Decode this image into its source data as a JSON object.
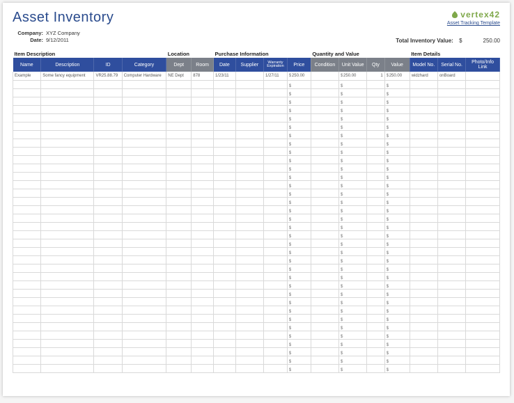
{
  "title": "Asset Inventory",
  "brand": {
    "name": "vertex42",
    "link_text": "Asset Tracking Template"
  },
  "meta": {
    "company_label": "Company:",
    "company": "XYZ Company",
    "date_label": "Date:",
    "date": "9/12/2011",
    "total_label": "Total Inventory Value:",
    "total_currency": "$",
    "total_value": "250.00"
  },
  "groups": {
    "item_desc": "Item Description",
    "location": "Location",
    "purchase": "Purchase Information",
    "quantity": "Quantity and Value",
    "details": "Item Details"
  },
  "columns": {
    "name": "Name",
    "desc": "Description",
    "id": "ID",
    "cat": "Category",
    "dept": "Dept",
    "room": "Room",
    "date": "Date",
    "supplier": "Supplier",
    "warranty": "Warranty Expiration",
    "price": "Price",
    "condition": "Condition",
    "unit_value": "Unit Value",
    "qty": "Qty",
    "value": "Value",
    "model": "Model No.",
    "serial": "Serial No.",
    "photo": "Photo/Info Link"
  },
  "rows": [
    {
      "name": "Example",
      "desc": "Some fancy equipment",
      "id": "VR25.88.79",
      "cat": "Computer Hardware",
      "dept": "NE Dept",
      "room": "878",
      "date": "1/23/11",
      "supplier": "",
      "warranty": "1/27/11",
      "price": "250.00",
      "condition": "",
      "unit_value": "250.00",
      "qty": "1",
      "value": "250.00",
      "model": "widzhard",
      "serial": "onBoard",
      "photo": ""
    }
  ],
  "empty_row_count": 35
}
